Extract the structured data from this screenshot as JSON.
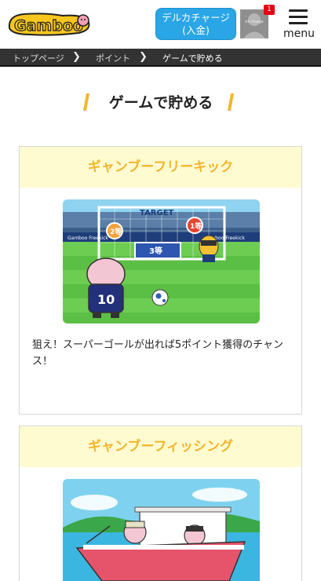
{
  "header": {
    "logo_text": "Gamboo",
    "charge_button": {
      "line1": "デルカチャージ",
      "line2": "(入金)"
    },
    "avatar_label": "no image",
    "notification_count": "1",
    "menu_label": "menu"
  },
  "breadcrumb": [
    "トップページ",
    "ポイント",
    "ゲームで貯める"
  ],
  "section_title": "ゲームで貯める",
  "games": [
    {
      "title": "ギャンブーフリーキック",
      "description": "狙え！スーパーゴールが出れば5ポイント獲得のチャンス！",
      "image": {
        "target_sign": "TARGET",
        "ball_left": "2等",
        "ball_right": "1等",
        "board": "3等",
        "player_number": "10",
        "banner_left": "Gamboo Freekick",
        "banner_right": "Gamboo Freekick"
      }
    },
    {
      "title": "ギャンブーフィッシング"
    }
  ],
  "colors": {
    "accent_yellow": "#f4b42c",
    "card_head_bg": "#fffbd0",
    "charge_blue": "#2aa6e6",
    "breadcrumb_bg": "#333333",
    "badge_red": "#e60012"
  }
}
